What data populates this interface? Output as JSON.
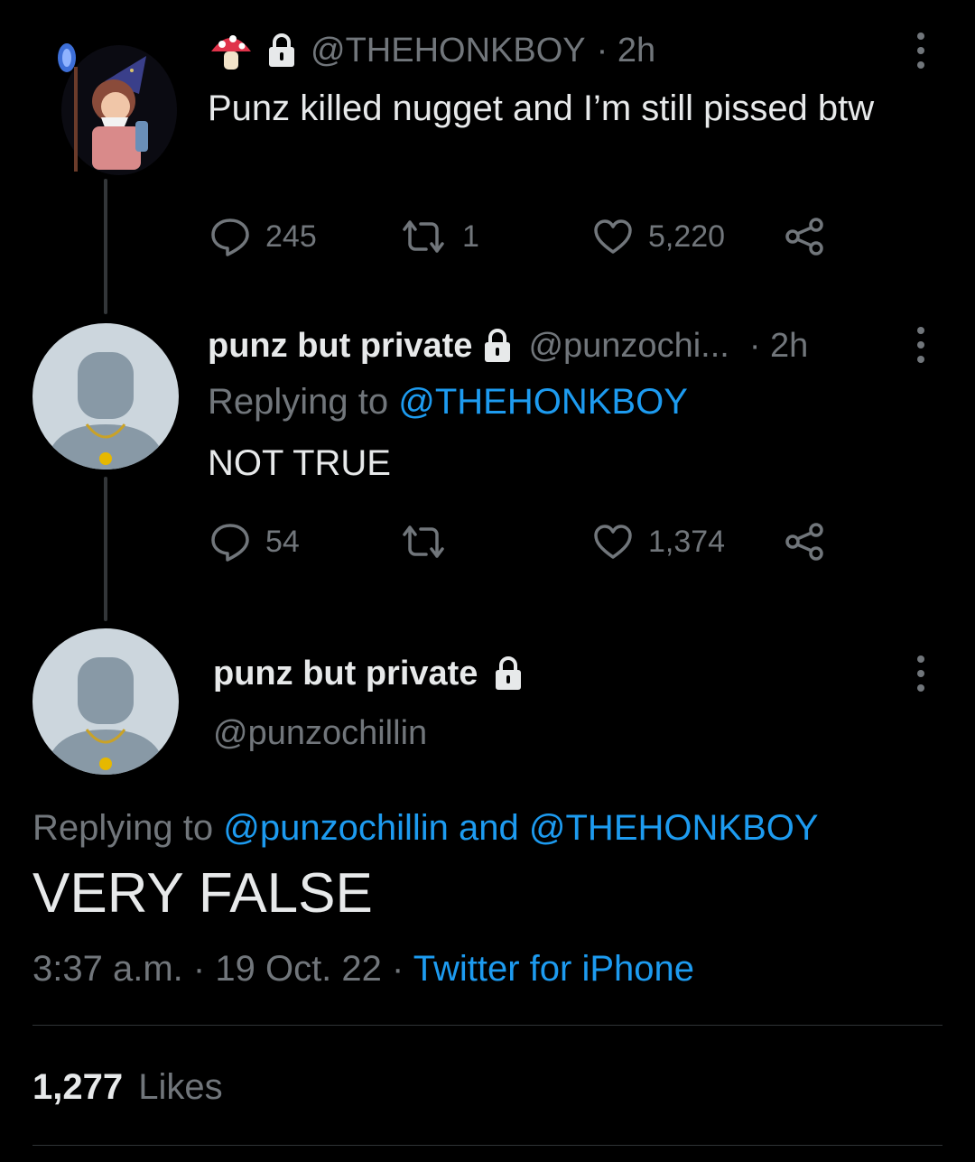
{
  "tweet1": {
    "handle": "@THEHONKBOY",
    "time": "· 2h",
    "text": "Punz killed nugget and I’m still pissed btw",
    "replies": "245",
    "retweets": "1",
    "likes": "5,220",
    "name_emoji_icon": "mushroom-icon"
  },
  "tweet2": {
    "name": "punz but private",
    "handle": "@punzochi...",
    "time": "· 2h",
    "replying_label": "Replying to",
    "replying_handle": "@THEHONKBOY",
    "text": "NOT TRUE",
    "replies": "54",
    "retweets": "",
    "likes": "1,374"
  },
  "main": {
    "name": "punz but private",
    "handle": "@punzochillin",
    "replying_label": "Replying to",
    "replying_handle_1": "@punzochillin",
    "replying_and": "and",
    "replying_handle_2": "@THEHONKBOY",
    "text": "VERY FALSE",
    "time": "3:37 a.m.",
    "sep1": "·",
    "date": "19 Oct. 22",
    "sep2": "·",
    "source": "Twitter for iPhone",
    "likes_count": "1,277",
    "likes_label": "Likes"
  },
  "colors": {
    "background": "#000000",
    "text": "#e7e9ea",
    "secondary": "#71767b",
    "accent": "#1d9bf0",
    "divider": "#2f3336"
  }
}
